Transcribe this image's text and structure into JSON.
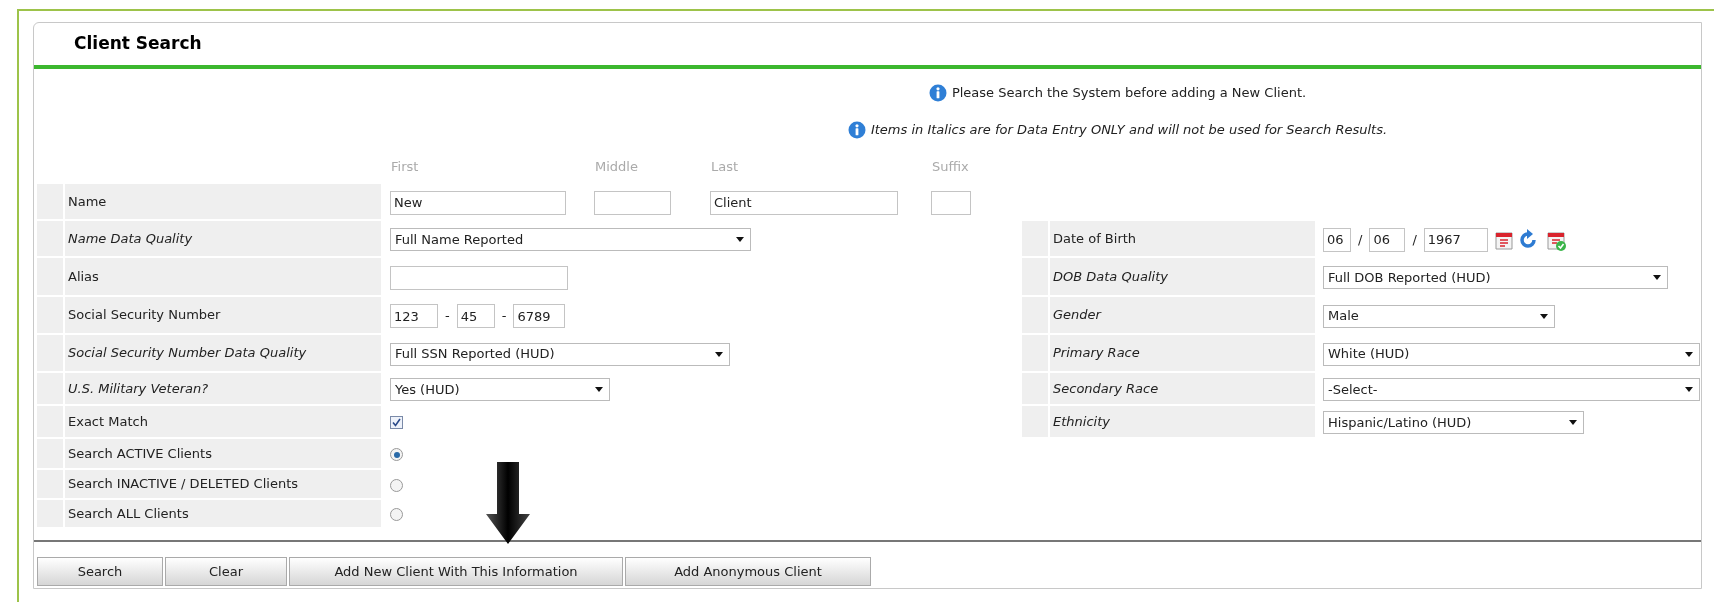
{
  "title": "Client Search",
  "notices": [
    {
      "text": "Please Search the System before adding a New Client.",
      "italic": false
    },
    {
      "text": "Items in Italics are for Data Entry ONLY and will not be used for Search Results.",
      "italic": true
    }
  ],
  "left_fields": [
    {
      "kind": "name",
      "label": "Name",
      "italic": false,
      "inputs": [
        {
          "header": "First",
          "value": "New"
        },
        {
          "header": "Middle"
        },
        {
          "header": "Last",
          "value": "Client"
        },
        {
          "header": "Suffix"
        }
      ]
    },
    {
      "kind": "select",
      "label": "Name Data Quality",
      "italic": true,
      "value": "Full Name Reported"
    },
    {
      "kind": "text",
      "label": "Alias",
      "italic": false
    },
    {
      "kind": "parts",
      "label": "Social Security Number",
      "italic": false,
      "parts": [
        "123",
        "45",
        "6789"
      ],
      "separators": [
        "-",
        "-"
      ]
    },
    {
      "kind": "select",
      "label": "Social Security Number Data Quality",
      "italic": true,
      "value": "Full SSN Reported (HUD)"
    },
    {
      "kind": "select",
      "label": "U.S. Military Veteran?",
      "italic": true,
      "value": "Yes (HUD)"
    },
    {
      "kind": "checkbox",
      "label": "Exact Match",
      "italic": false,
      "checked": true
    },
    {
      "kind": "radio",
      "label": "Search ACTIVE Clients",
      "italic": false,
      "selected": true
    },
    {
      "kind": "radio",
      "label": "Search INACTIVE / DELETED Clients",
      "italic": false,
      "selected": false
    },
    {
      "kind": "radio",
      "label": "Search ALL Clients",
      "italic": false,
      "selected": false
    }
  ],
  "right_fields": [
    {
      "kind": "date",
      "label": "Date of Birth",
      "italic": false,
      "parts": [
        "06",
        "06",
        "1967"
      ],
      "separators": [
        "/",
        "/"
      ]
    },
    {
      "kind": "select",
      "label": "DOB Data Quality",
      "italic": true,
      "value": "Full DOB Reported (HUD)"
    },
    {
      "kind": "select",
      "label": "Gender",
      "italic": true,
      "value": "Male"
    },
    {
      "kind": "select",
      "label": "Primary Race",
      "italic": true,
      "value": "White (HUD)"
    },
    {
      "kind": "select",
      "label": "Secondary Race",
      "italic": true,
      "value": "-Select-"
    },
    {
      "kind": "select",
      "label": "Ethnicity",
      "italic": true,
      "value": "Hispanic/Latino (HUD)"
    }
  ],
  "buttons": [
    "Search",
    "Clear",
    "Add New Client With This Information",
    "Add Anonymous Client"
  ]
}
